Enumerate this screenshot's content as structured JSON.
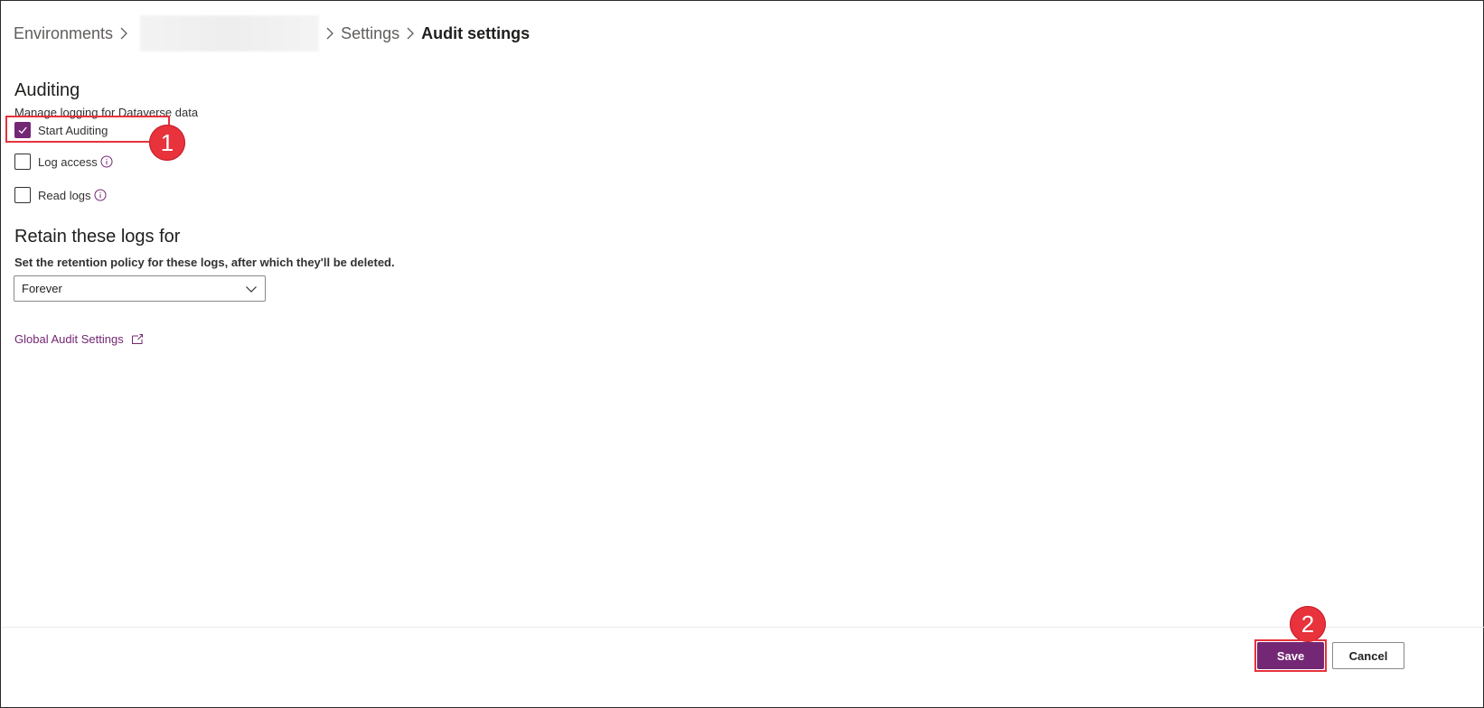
{
  "breadcrumb": {
    "items": [
      "Environments",
      "",
      "Settings",
      "Audit settings"
    ]
  },
  "auditing": {
    "title": "Auditing",
    "description": "Manage logging for Dataverse data",
    "options": [
      {
        "label": "Start Auditing",
        "checked": true
      },
      {
        "label": "Log access",
        "checked": false,
        "info": true
      },
      {
        "label": "Read logs",
        "checked": false,
        "info": true
      }
    ]
  },
  "retention": {
    "title": "Retain these logs for",
    "description": "Set the retention policy for these logs, after which they'll be deleted.",
    "selected": "Forever"
  },
  "global_link": {
    "label": "Global Audit Settings"
  },
  "annotations": {
    "step1": "1",
    "step2": "2"
  },
  "footer": {
    "save_label": "Save",
    "cancel_label": "Cancel"
  },
  "colors": {
    "accent": "#742774",
    "annotation": "#e8323c"
  },
  "icons": [
    "chevron-right-icon",
    "checkmark-icon",
    "info-icon",
    "chevron-down-icon",
    "external-link-icon"
  ]
}
